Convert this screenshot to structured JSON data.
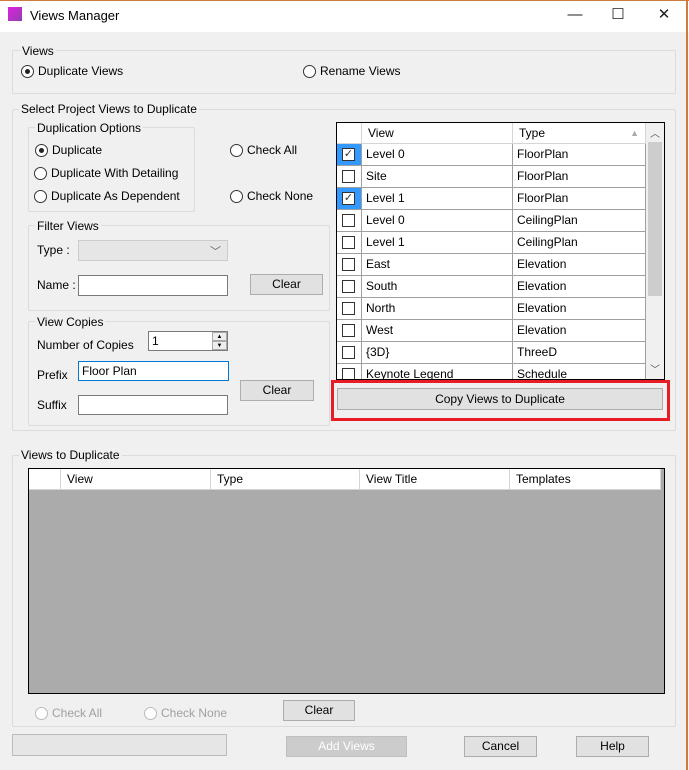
{
  "window": {
    "title": "Views Manager",
    "minimize": "—",
    "maximize": "☐",
    "close": "✕"
  },
  "views_group": {
    "label": "Views",
    "options": [
      {
        "label": "Duplicate Views",
        "selected": true
      },
      {
        "label": "Rename Views",
        "selected": false
      }
    ]
  },
  "select_group": {
    "label": "Select Project Views to Duplicate"
  },
  "duplication_options": {
    "label": "Duplication Options",
    "options": [
      {
        "label": "Duplicate",
        "selected": true
      },
      {
        "label": "Duplicate With Detailing",
        "selected": false
      },
      {
        "label": "Duplicate As Dependent",
        "selected": false
      }
    ],
    "check_all": "Check All",
    "check_none": "Check None"
  },
  "filter_views": {
    "label": "Filter Views",
    "type_label": "Type :",
    "type_value": "",
    "name_label": "Name :",
    "name_value": "",
    "clear": "Clear"
  },
  "view_copies": {
    "label": "View Copies",
    "number_label": "Number of Copies",
    "number_value": "1",
    "prefix_label": "Prefix",
    "prefix_value": "Floor Plan",
    "suffix_label": "Suffix",
    "suffix_value": "",
    "clear": "Clear"
  },
  "project_views": {
    "columns": [
      "View",
      "Type"
    ],
    "rows": [
      {
        "checked": true,
        "view": "Level 0",
        "type": "FloorPlan"
      },
      {
        "checked": false,
        "view": "Site",
        "type": "FloorPlan"
      },
      {
        "checked": true,
        "view": "Level 1",
        "type": "FloorPlan"
      },
      {
        "checked": false,
        "view": "Level 0",
        "type": "CeilingPlan"
      },
      {
        "checked": false,
        "view": "Level 1",
        "type": "CeilingPlan"
      },
      {
        "checked": false,
        "view": "East",
        "type": "Elevation"
      },
      {
        "checked": false,
        "view": "South",
        "type": "Elevation"
      },
      {
        "checked": false,
        "view": "North",
        "type": "Elevation"
      },
      {
        "checked": false,
        "view": "West",
        "type": "Elevation"
      },
      {
        "checked": false,
        "view": "{3D}",
        "type": "ThreeD"
      },
      {
        "checked": false,
        "view": "Keynote Legend",
        "type": "Schedule"
      }
    ],
    "copy_button": "Copy Views to Duplicate",
    "highlight_color": "#e81c24"
  },
  "views_to_duplicate": {
    "label": "Views to Duplicate",
    "columns": [
      "View",
      "Type",
      "View Title",
      "Templates"
    ],
    "check_all": "Check All",
    "check_none": "Check None",
    "clear": "Clear"
  },
  "footer": {
    "status": "",
    "add_views": "Add Views",
    "cancel": "Cancel",
    "help": "Help"
  }
}
